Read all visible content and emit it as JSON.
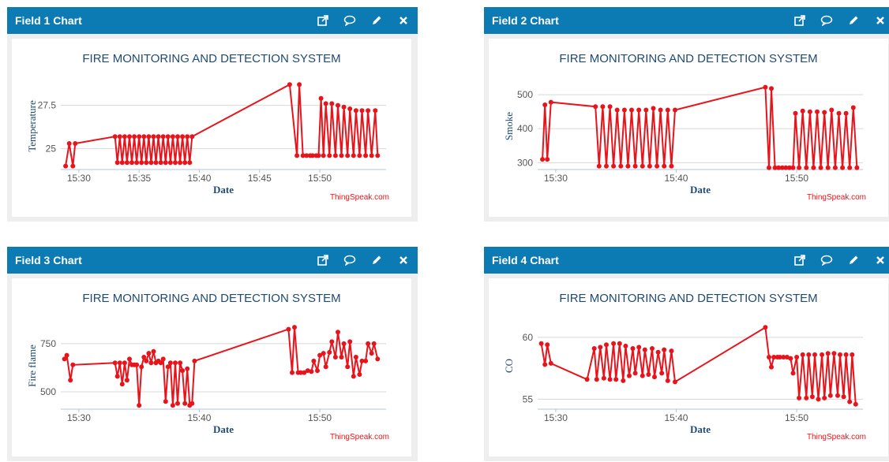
{
  "panels": [
    {
      "title": "Field 1 Chart",
      "icons": [
        "external-link-icon",
        "comment-icon",
        "edit-pencil-icon",
        "close-icon"
      ]
    },
    {
      "title": "Field 2 Chart",
      "icons": [
        "external-link-icon",
        "comment-icon",
        "edit-pencil-icon",
        "close-icon"
      ]
    },
    {
      "title": "Field 3 Chart",
      "icons": [
        "external-link-icon",
        "comment-icon",
        "edit-pencil-icon",
        "close-icon"
      ]
    },
    {
      "title": "Field 4 Chart",
      "icons": [
        "external-link-icon",
        "comment-icon",
        "edit-pencil-icon",
        "close-icon"
      ]
    }
  ],
  "colors": {
    "header": "#0c7bb4",
    "series": "#e8141c",
    "title_text": "#1f4a73",
    "credit": "#e8141c",
    "axis_text": "#1f4a73"
  },
  "chart_data": [
    {
      "type": "line",
      "title": "FIRE MONITORING AND DETECTION SYSTEM",
      "xlabel": "Date",
      "ylabel": "Temperature",
      "credit": "ThingSpeak.com",
      "xlim": [
        28.5,
        55.5
      ],
      "ylim": [
        23.8,
        28.8
      ],
      "yticks": [
        25,
        27.5
      ],
      "ytick_labels": [
        "25",
        "27.5"
      ],
      "xticks": [
        30,
        35,
        40,
        45,
        50
      ],
      "xtick_labels": [
        "15:30",
        "15:35",
        "15:40",
        "15:45",
        "15:50"
      ],
      "x": [
        28.9,
        29.2,
        29.5,
        29.7,
        33,
        33.2,
        33.4,
        33.6,
        33.8,
        34,
        34.2,
        34.4,
        34.6,
        34.8,
        35,
        35.2,
        35.4,
        35.6,
        35.8,
        36,
        36.2,
        36.4,
        36.6,
        36.8,
        37,
        37.2,
        37.4,
        37.6,
        37.8,
        38,
        38.2,
        38.4,
        38.6,
        38.8,
        39,
        39.2,
        39.4,
        47.5,
        48.1,
        48.3,
        48.6,
        48.9,
        49.2,
        49.4,
        49.7,
        49.9,
        50.1,
        50.3,
        50.5,
        50.8,
        51,
        51.3,
        51.5,
        51.8,
        52,
        52.3,
        52.5,
        52.8,
        53,
        53.3,
        53.5,
        53.8,
        54,
        54.3,
        54.6,
        54.8
      ],
      "y": [
        24,
        25.3,
        24,
        25.3,
        25.7,
        24.2,
        25.7,
        24.2,
        25.7,
        24.2,
        25.7,
        24.2,
        25.7,
        24.2,
        25.7,
        24.2,
        25.7,
        24.2,
        25.7,
        24.2,
        25.7,
        24.2,
        25.7,
        24.2,
        25.7,
        24.2,
        25.7,
        24.2,
        25.7,
        24.2,
        25.7,
        24.2,
        25.7,
        24.2,
        25.7,
        24.2,
        25.7,
        28.7,
        24.6,
        28.7,
        24.6,
        24.6,
        24.6,
        24.6,
        24.6,
        24.6,
        27.9,
        24.6,
        27.6,
        24.6,
        27.6,
        24.6,
        27.5,
        24.6,
        27.4,
        24.6,
        27.3,
        24.6,
        27.2,
        24.6,
        27.2,
        24.6,
        27.2,
        24.6,
        27.2,
        24.6
      ],
      "grid": true
    },
    {
      "type": "line",
      "title": "FIRE MONITORING AND DETECTION SYSTEM",
      "xlabel": "Date",
      "ylabel": "Smoke",
      "credit": "ThingSpeak.com",
      "xlim": [
        28.5,
        55.5
      ],
      "ylim": [
        280,
        535
      ],
      "yticks": [
        300,
        400,
        500
      ],
      "ytick_labels": [
        "300",
        "400",
        "500"
      ],
      "xticks": [
        30,
        40,
        50
      ],
      "xtick_labels": [
        "15:30",
        "15:40",
        "15:50"
      ],
      "x": [
        28.9,
        29.1,
        29.3,
        29.6,
        33.3,
        33.6,
        33.9,
        34.2,
        34.5,
        34.8,
        35.1,
        35.4,
        35.7,
        36,
        36.3,
        36.6,
        36.9,
        37.2,
        37.5,
        37.8,
        38.1,
        38.4,
        38.7,
        39,
        39.3,
        39.6,
        39.9,
        47.4,
        47.7,
        47.9,
        48.2,
        48.5,
        48.8,
        49.1,
        49.4,
        49.7,
        49.9,
        50.2,
        50.5,
        50.8,
        51.1,
        51.4,
        51.7,
        52,
        52.3,
        52.6,
        52.9,
        53.2,
        53.5,
        53.8,
        54.1,
        54.4,
        54.7,
        55
      ],
      "y": [
        310,
        470,
        310,
        478,
        465,
        290,
        465,
        290,
        465,
        290,
        455,
        290,
        455,
        290,
        455,
        290,
        455,
        290,
        455,
        290,
        460,
        290,
        455,
        290,
        455,
        290,
        455,
        522,
        285,
        518,
        285,
        285,
        285,
        285,
        285,
        285,
        445,
        285,
        452,
        285,
        450,
        285,
        450,
        285,
        448,
        285,
        455,
        285,
        445,
        285,
        445,
        285,
        462,
        285
      ],
      "grid": true
    },
    {
      "type": "line",
      "title": "FIRE MONITORING AND DETECTION SYSTEM",
      "xlabel": "Date",
      "ylabel": "Fire flame",
      "credit": "ThingSpeak.com",
      "xlim": [
        28.5,
        55.5
      ],
      "ylim": [
        410,
        860
      ],
      "yticks": [
        500,
        750
      ],
      "ytick_labels": [
        "500",
        "750"
      ],
      "xticks": [
        30,
        40,
        50
      ],
      "xtick_labels": [
        "15:30",
        "15:40",
        "15:50"
      ],
      "x": [
        28.8,
        29,
        29.3,
        29.5,
        33,
        33.2,
        33.4,
        33.6,
        33.8,
        34,
        34.2,
        34.4,
        34.6,
        34.8,
        35,
        35.2,
        35.4,
        35.6,
        35.8,
        36,
        36.2,
        36.4,
        36.6,
        36.8,
        37,
        37.2,
        37.4,
        37.6,
        37.8,
        38,
        38.2,
        38.4,
        38.6,
        38.8,
        39,
        39.2,
        39.4,
        39.6,
        47.4,
        47.7,
        47.9,
        48.2,
        48.4,
        48.7,
        49,
        49.3,
        49.5,
        49.8,
        50,
        50.3,
        50.5,
        50.8,
        51,
        51.3,
        51.5,
        51.8,
        52,
        52.3,
        52.5,
        52.8,
        53,
        53.3,
        53.5,
        53.8,
        54,
        54.3,
        54.5,
        54.8
      ],
      "y": [
        670,
        690,
        560,
        640,
        650,
        580,
        650,
        540,
        650,
        560,
        670,
        640,
        640,
        640,
        430,
        630,
        680,
        660,
        700,
        650,
        710,
        650,
        660,
        650,
        670,
        450,
        630,
        650,
        430,
        650,
        440,
        650,
        610,
        440,
        620,
        430,
        440,
        660,
        825,
        600,
        835,
        600,
        600,
        600,
        610,
        605,
        660,
        610,
        690,
        700,
        630,
        705,
        760,
        680,
        810,
        680,
        750,
        630,
        760,
        580,
        680,
        590,
        660,
        660,
        750,
        700,
        750,
        670
      ],
      "grid": true
    },
    {
      "type": "line",
      "title": "FIRE MONITORING AND DETECTION SYSTEM",
      "xlabel": "Date",
      "ylabel": "CO",
      "credit": "ThingSpeak.com",
      "xlim": [
        28.5,
        55.5
      ],
      "ylim": [
        54.2,
        61.2
      ],
      "yticks": [
        55,
        60
      ],
      "ytick_labels": [
        "55",
        "60"
      ],
      "xticks": [
        30,
        40,
        50
      ],
      "xtick_labels": [
        "15:30",
        "15:40",
        "15:50"
      ],
      "x": [
        28.8,
        29.1,
        29.3,
        29.6,
        32.6,
        33.2,
        33.4,
        33.7,
        34,
        34.2,
        34.5,
        34.8,
        35,
        35.3,
        35.6,
        35.8,
        36.1,
        36.4,
        36.6,
        36.9,
        37.2,
        37.4,
        37.7,
        38,
        38.2,
        38.5,
        38.8,
        39,
        39.3,
        39.6,
        39.9,
        47.4,
        47.7,
        47.9,
        48.1,
        48.4,
        48.6,
        48.9,
        49.2,
        49.5,
        49.7,
        50,
        50.2,
        50.5,
        50.8,
        51,
        51.3,
        51.5,
        51.8,
        52.1,
        52.3,
        52.6,
        52.8,
        53.1,
        53.4,
        53.6,
        53.9,
        54.1,
        54.4,
        54.6,
        54.9
      ],
      "y": [
        59.5,
        57.8,
        59.4,
        57.9,
        56.6,
        59.1,
        56.6,
        59.2,
        56.7,
        59.4,
        56.6,
        59.5,
        56.6,
        59.5,
        56.5,
        59.3,
        56.9,
        59.1,
        57.1,
        59.2,
        56.9,
        59,
        57,
        59.1,
        56.8,
        58.8,
        57.1,
        59,
        56.5,
        58.9,
        56.4,
        60.8,
        58.4,
        57.6,
        58.4,
        58.4,
        58.4,
        58.4,
        58.4,
        58.3,
        57.1,
        58.4,
        55.1,
        58.6,
        55.1,
        58.6,
        55.2,
        58.6,
        55,
        58.6,
        55.1,
        58.7,
        55.3,
        58.7,
        55.3,
        58.6,
        55.2,
        58.6,
        54.8,
        58.6,
        54.6
      ],
      "grid": true
    }
  ]
}
